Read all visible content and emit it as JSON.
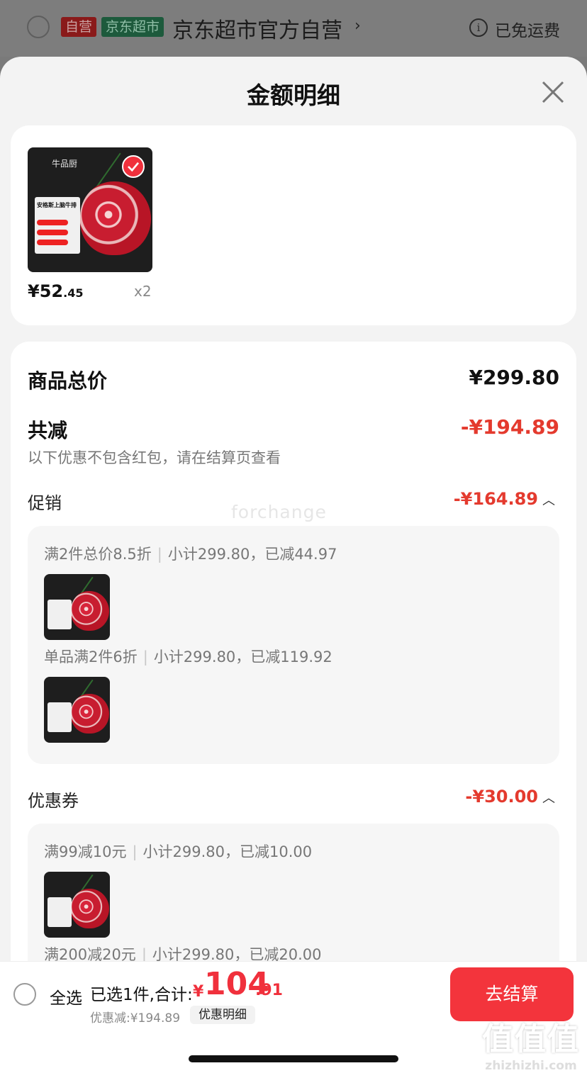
{
  "store": {
    "tag_self": "自营",
    "tag_super": "京东超市",
    "name": "京东超市官方自营",
    "chevron": "›",
    "info": "i",
    "shipping": "已免运费"
  },
  "sheet": {
    "title": "金额明细"
  },
  "product": {
    "brand": "牛品厨",
    "name": "安格斯上脑牛排",
    "price_int": "¥52",
    "price_dec": ".45",
    "qty": "x2"
  },
  "summary": {
    "total_label": "商品总价",
    "total_value": "¥299.80",
    "reduce_label": "共减",
    "reduce_value": "-¥194.89",
    "note": "以下优惠不包含红包，请在结算页查看"
  },
  "promotion": {
    "label": "促销",
    "value": "-¥164.89",
    "items": [
      {
        "rule": "满2件总价8.5折",
        "detail": "小计299.80，已减44.97"
      },
      {
        "rule": "单品满2件6折",
        "detail": "小计299.80，已减119.92"
      }
    ]
  },
  "coupon": {
    "label": "优惠券",
    "value": "-¥30.00",
    "items": [
      {
        "rule": "满99减10元",
        "detail": "小计299.80，已减10.00"
      },
      {
        "rule": "满200减20元",
        "detail": "小计299.80，已减20.00"
      }
    ]
  },
  "watermark": "forchange",
  "bottom": {
    "select_all": "全选",
    "selected": "已选1件,合计:",
    "total_symbol": "¥",
    "total_int": "104",
    "total_dec": ".91",
    "discount": "优惠减:¥194.89",
    "discount_detail": "优惠明细",
    "checkout": "去结算"
  },
  "site_watermark": {
    "big": "值值值",
    "small": "zhizhizhi.com"
  },
  "colors": {
    "accent_red": "#f0303c",
    "discount_red": "#e43a2e"
  }
}
